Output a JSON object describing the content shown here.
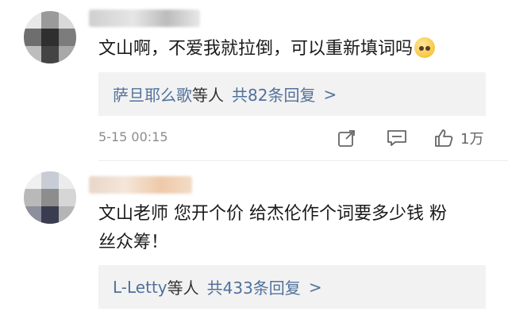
{
  "comments": [
    {
      "text": "文山啊，不爱我就拉倒，可以重新填词吗",
      "emoji_icon": "pleading-face-emoji",
      "replies": {
        "users": "萨旦耶么歌",
        "suffix": "等人",
        "count": "共82条回复",
        "arrow": ">"
      },
      "timestamp": "5-15 00:15",
      "likes": "1万"
    },
    {
      "text_line1": "文山老师 您开个价 给杰伦作个词要多少钱 粉",
      "text_line2": "丝众筹！",
      "replies": {
        "users": "L-Letty",
        "suffix": "等人",
        "count": "共433条回复",
        "arrow": ">"
      }
    }
  ],
  "colors": {
    "link": "#51719b",
    "meta": "#8c8c8c",
    "reply_bg": "#f2f2f2"
  }
}
